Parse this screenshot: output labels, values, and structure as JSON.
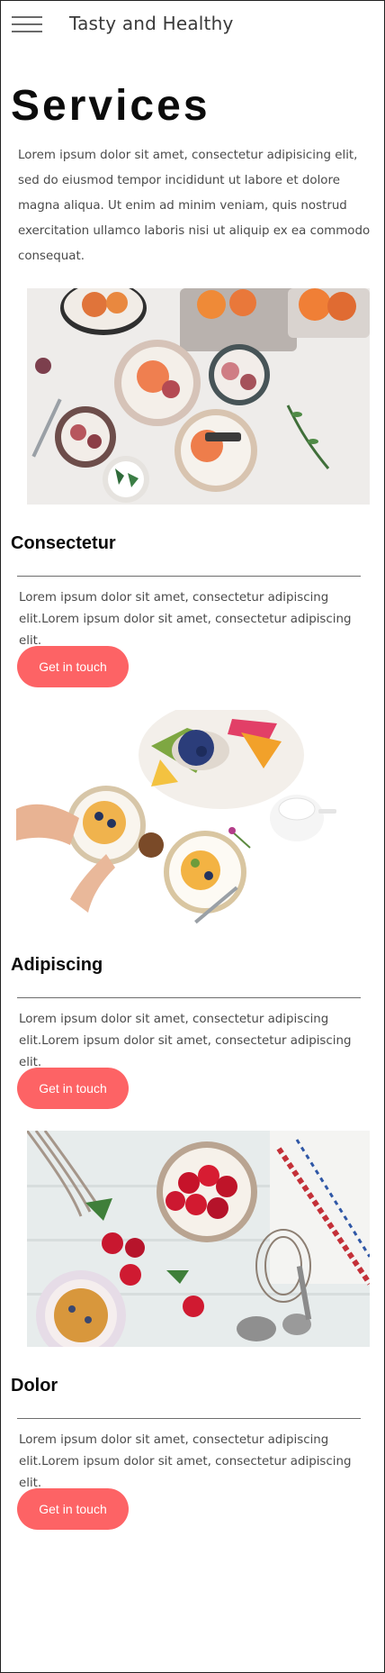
{
  "header": {
    "brand": "Tasty and Healthy",
    "menu_icon": "hamburger-menu-icon"
  },
  "page": {
    "title": "Services",
    "intro": "Lorem ipsum dolor sit amet, consectetur adipisicing elit, sed do eiusmod tempor incididunt ut labore et dolore magna aliqua. Ut enim ad minim veniam, quis nostrud exercitation ullamco laboris nisi ut aliquip ex ea commodo consequat."
  },
  "services": [
    {
      "title": "Consectetur",
      "text": "Lorem ipsum dolor sit amet, consectetur adipiscing elit.Lorem ipsum dolor sit amet, consectetur adipiscing elit.",
      "button": "Get in touch",
      "image": "plated-figs-and-grapefruit-photo"
    },
    {
      "title": "Adipiscing",
      "text": "Lorem ipsum dolor sit amet, consectetur adipiscing elit.Lorem ipsum dolor sit amet, consectetur adipiscing elit.",
      "button": "Get in touch",
      "image": "fruit-platter-and-pancakes-photo"
    },
    {
      "title": "Dolor",
      "text": "Lorem ipsum dolor sit amet, consectetur adipiscing elit.Lorem ipsum dolor sit amet, consectetur adipiscing elit.",
      "button": "Get in touch",
      "image": "cherries-and-tart-photo"
    }
  ],
  "colors": {
    "button": "#fd6365",
    "button_text": "#ffffff",
    "title": "#0c0c0c",
    "body_text": "#4a4a4a",
    "divider": "#6d6d6d"
  }
}
